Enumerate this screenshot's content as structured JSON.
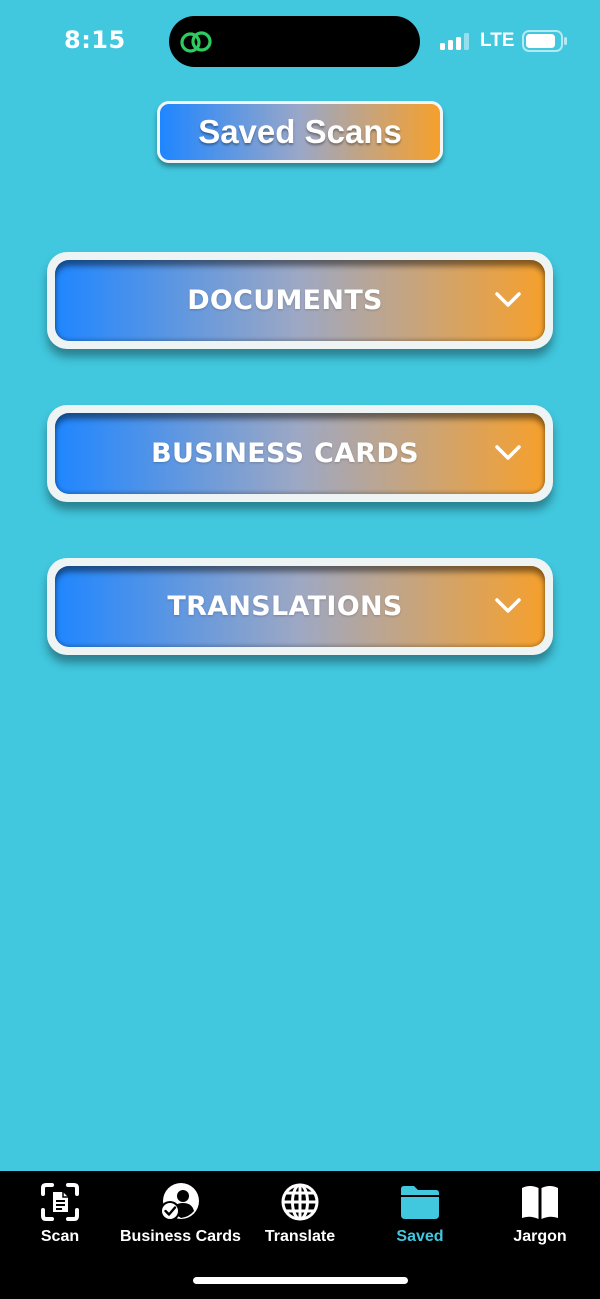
{
  "status_bar": {
    "time": "8:15",
    "carrier": "LTE",
    "island_icon": "link-icon",
    "battery_icon": "battery-icon",
    "signal_icon": "cellular-signal-icon"
  },
  "header": {
    "title": "Saved Scans"
  },
  "categories": [
    {
      "label": "DOCUMENTS",
      "icon": "chevron-down-icon"
    },
    {
      "label": "BUSINESS CARDS",
      "icon": "chevron-down-icon"
    },
    {
      "label": "TRANSLATIONS",
      "icon": "chevron-down-icon"
    }
  ],
  "tab_bar": {
    "active_index": 3,
    "tabs": [
      {
        "label": "Scan",
        "icon": "document-scan-icon"
      },
      {
        "label": "Business Cards",
        "icon": "person-check-icon"
      },
      {
        "label": "Translate",
        "icon": "globe-icon"
      },
      {
        "label": "Saved",
        "icon": "folder-icon"
      },
      {
        "label": "Jargon",
        "icon": "book-icon"
      }
    ]
  },
  "colors": {
    "background": "#41c7de",
    "gradient_start": "#1f86ff",
    "gradient_end": "#f6a02c",
    "tab_bar": "#000000",
    "active_tab": "#41c7de",
    "link_icon_green": "#2ecc5e"
  }
}
